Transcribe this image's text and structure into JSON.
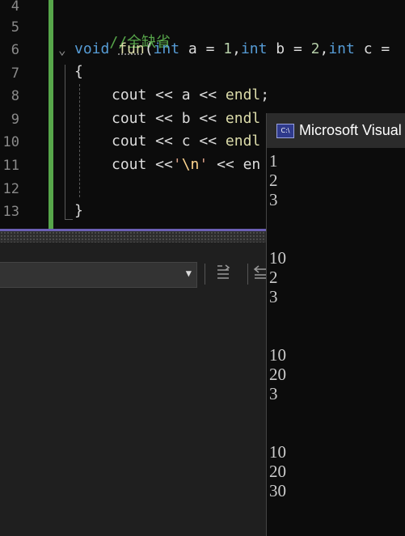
{
  "editor": {
    "line_numbers": [
      "4",
      "5",
      "6",
      "7",
      "8",
      "9",
      "10",
      "11",
      "12",
      "13"
    ],
    "lines": {
      "l5": {
        "comment": "//全缺省"
      },
      "l6": {
        "kw1": "void",
        "fn": "fun",
        "p1": "(",
        "kw2": "int",
        "t1": " a = ",
        "n1": "1",
        "t2": ",",
        "kw3": "int",
        "t3": " b = ",
        "n2": "2",
        "t4": ",",
        "kw4": "int",
        "t5": " c ="
      },
      "l7": {
        "brace": "{"
      },
      "l8": {
        "text": "cout << a << ",
        "fn": "endl",
        ";": ";"
      },
      "l9": {
        "text": "cout << b << ",
        "fn": "endl"
      },
      "l10": {
        "text": "cout << c << ",
        "fn": "endl"
      },
      "l11": {
        "text": "cout <<",
        "q1": "'",
        "esc": "\\n",
        "q2": "'",
        "text2": " << en"
      },
      "l13": {
        "brace": "}"
      }
    }
  },
  "output_toolbar": {
    "dropdown_value": "",
    "dropdown_icon": "chevron-down-icon"
  },
  "console": {
    "title": "Microsoft Visual",
    "icon_text": "C:\\",
    "output": [
      "1",
      "2",
      "3",
      "",
      "",
      "10",
      "2",
      "3",
      "",
      "",
      "10",
      "20",
      "3",
      "",
      "",
      "10",
      "20",
      "30"
    ]
  }
}
